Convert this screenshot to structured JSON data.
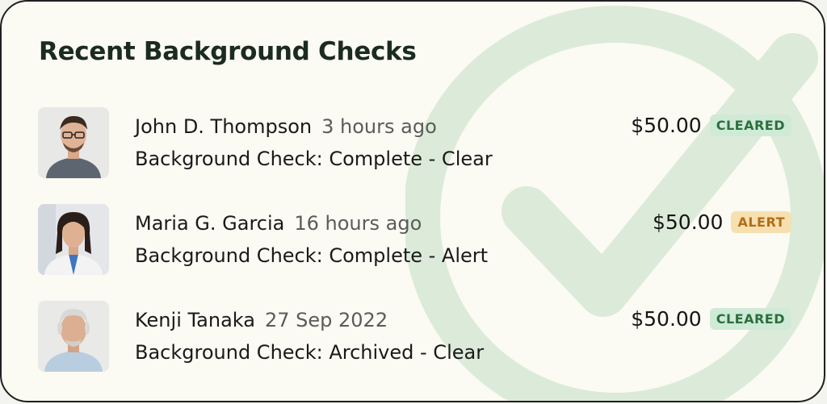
{
  "title": "Recent Background Checks",
  "colors": {
    "cleared_badge_bg": "#cfead7",
    "cleared_badge_text": "#2c6f3d",
    "alert_badge_bg": "#f7e0b0",
    "alert_badge_text": "#b06f1a",
    "watermark": "#dcebd9"
  },
  "watermark_icon": "check-circle-icon",
  "checks": [
    {
      "name": "John D. Thompson",
      "time": "3 hours ago",
      "description": "Background Check: Complete - Clear",
      "amount": "$50.00",
      "status": "CLEARED"
    },
    {
      "name": "Maria G. Garcia",
      "time": "16 hours ago",
      "description": "Background Check: Complete - Alert",
      "amount": "$50.00",
      "status": "ALERT"
    },
    {
      "name": "Kenji Tanaka",
      "time": "27 Sep 2022",
      "description": "Background Check: Archived - Clear",
      "amount": "$50.00",
      "status": "CLEARED"
    }
  ]
}
